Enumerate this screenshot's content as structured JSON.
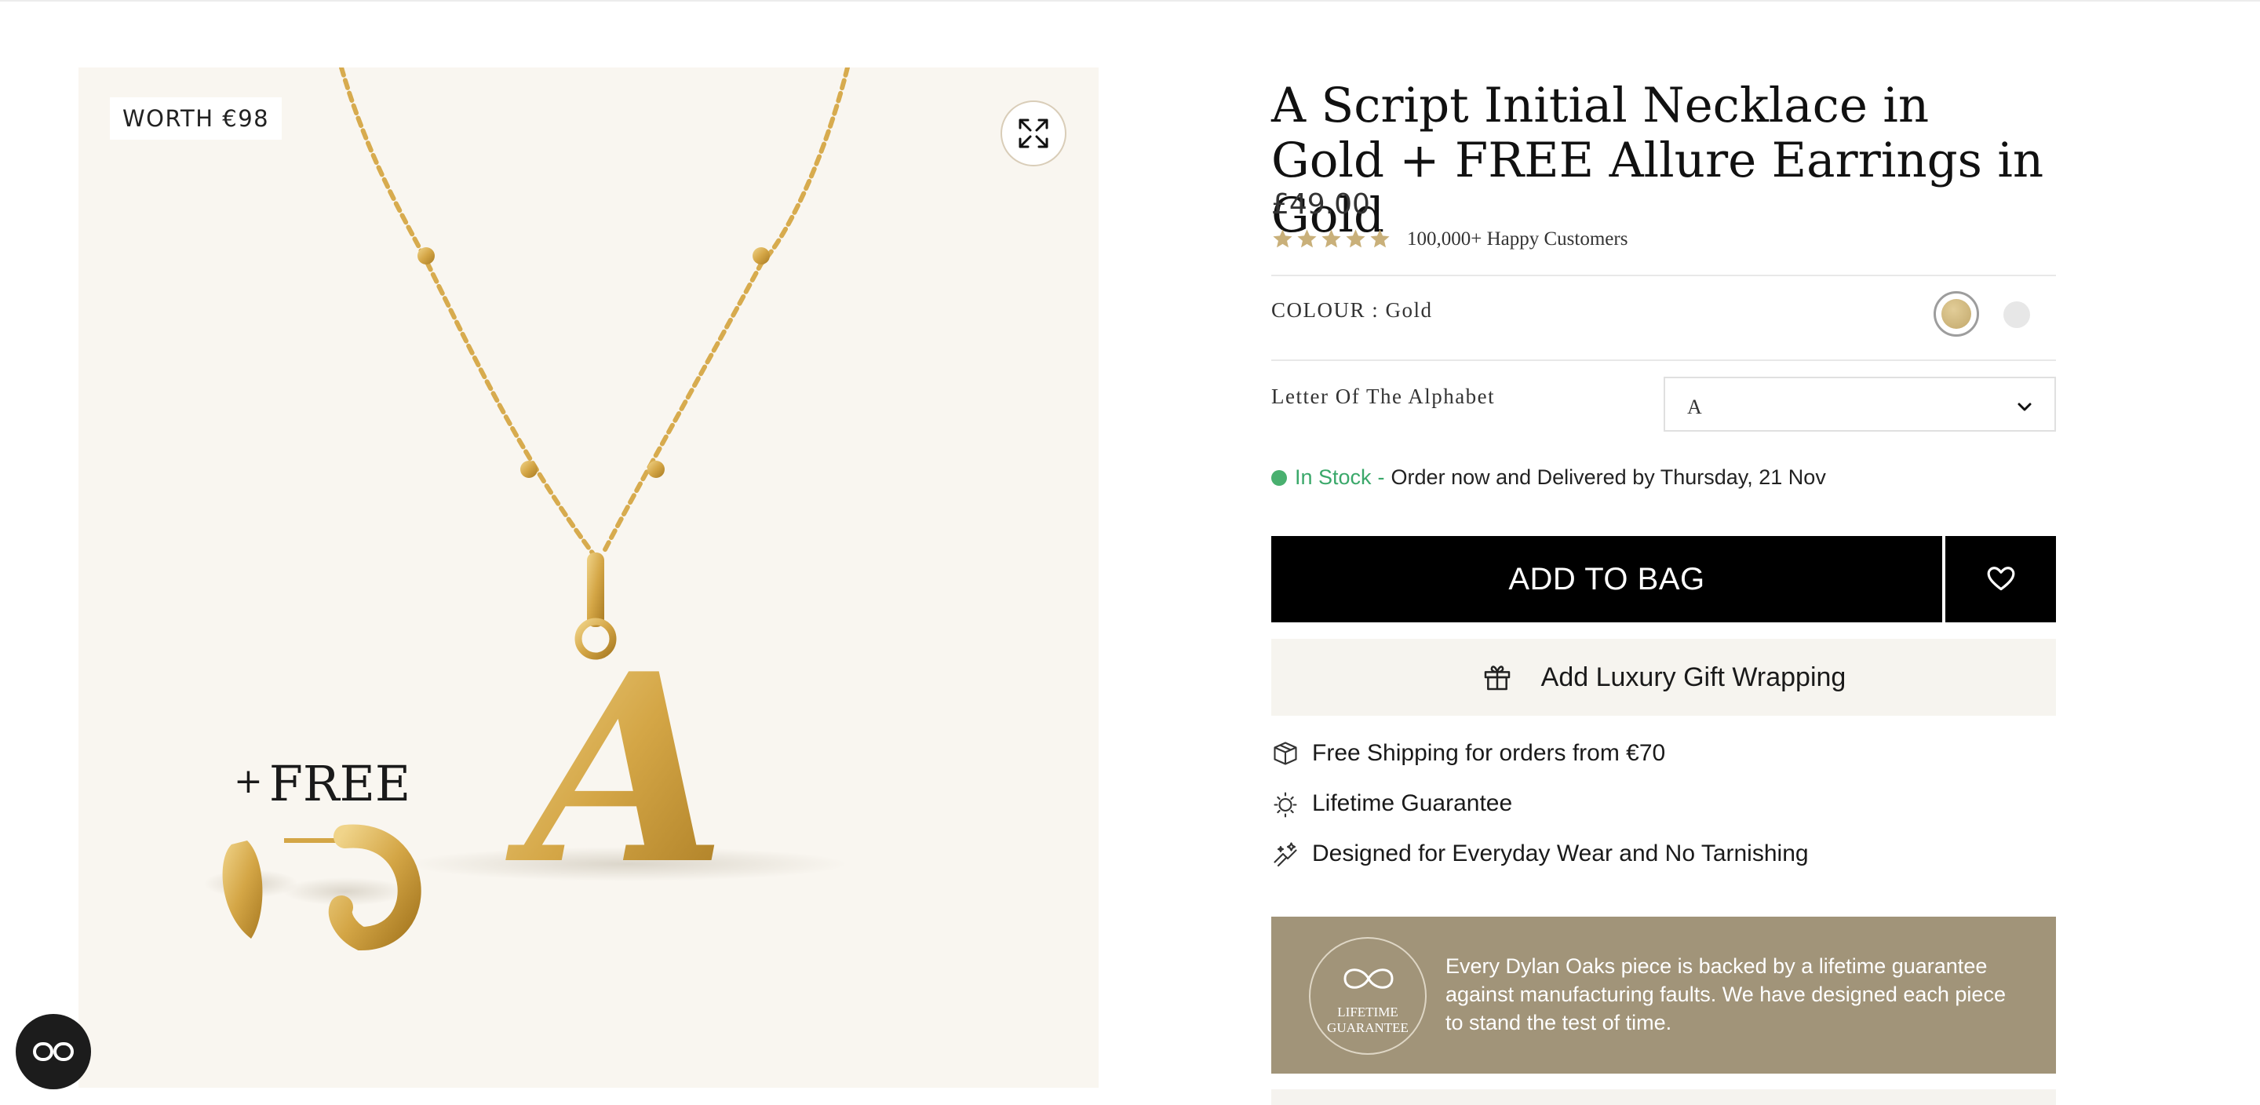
{
  "gallery": {
    "worth_badge": "WORTH €98",
    "free_plus": "+",
    "free_label": "FREE",
    "pendant_letter": "A"
  },
  "product": {
    "title": "A Script Initial Necklace in Gold + FREE Allure Earrings in Gold",
    "price": "£49.00",
    "rating_stars": 5,
    "rating_text": "100,000+ Happy Customers",
    "colour_label": "COLOUR : Gold",
    "colours": [
      {
        "name": "gold",
        "hex": "#c9b07a",
        "selected": true
      },
      {
        "name": "silver",
        "hex": "#e7e7e7",
        "selected": false
      }
    ],
    "letter_label": "Letter Of The Alphabet",
    "letter_value": "A"
  },
  "stock": {
    "status": "In Stock",
    "separator": "-",
    "delivery": "Order now and Delivered by Thursday, 21 Nov"
  },
  "actions": {
    "add_to_bag": "ADD TO BAG",
    "gift_wrap": "Add Luxury Gift Wrapping"
  },
  "benefits": [
    {
      "icon": "box-icon",
      "text": "Free Shipping for orders from €70"
    },
    {
      "icon": "shield-sun-icon",
      "text": "Lifetime Guarantee"
    },
    {
      "icon": "sparkle-jewel-icon",
      "text": "Designed for Everyday Wear and No Tarnishing"
    }
  ],
  "guarantee": {
    "badge_line1": "LIFETIME",
    "badge_line2": "GUARANTEE",
    "text": "Every Dylan Oaks piece is backed by a lifetime guarantee against manufacturing faults. We have designed each piece to stand the test of time."
  },
  "colors": {
    "accent_gold": "#c9b07a",
    "in_stock_green": "#3aa86a",
    "guarantee_panel": "#a19479",
    "button_black": "#000000"
  }
}
